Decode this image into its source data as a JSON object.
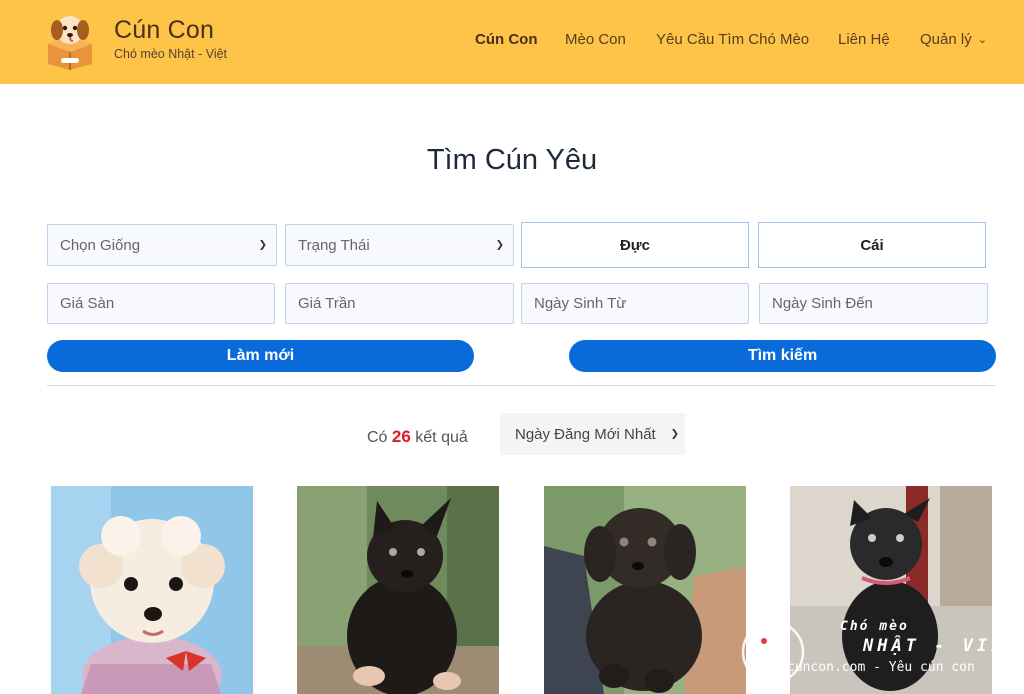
{
  "header": {
    "brand_title": "Cún Con",
    "brand_subtitle": "Chó mèo Nhật - Việt",
    "logo_icon": "puppy-in-box-logo",
    "nav": [
      {
        "label": "Cún Con",
        "active": true
      },
      {
        "label": "Mèo Con",
        "active": false
      },
      {
        "label": "Yêu Cầu Tìm Chó Mèo",
        "active": false
      },
      {
        "label": "Liên Hệ",
        "active": false
      },
      {
        "label": "Quản lý",
        "active": false,
        "dropdown": true
      }
    ]
  },
  "page": {
    "title": "Tìm Cún Yêu"
  },
  "filters": {
    "breed_select": "Chọn Giống",
    "status_select": "Trạng Thái",
    "male_button": "Đực",
    "female_button": "Cái",
    "price_min_placeholder": "Giá Sàn",
    "price_max_placeholder": "Giá Trần",
    "birth_from_placeholder": "Ngày Sinh Từ",
    "birth_to_placeholder": "Ngày Sinh Đến",
    "reset_button": "Làm mới",
    "search_button": "Tìm kiếm"
  },
  "results": {
    "prefix": "Có",
    "count": "26",
    "suffix": "kết quả",
    "sort_select": "Ngày Đăng Mới Nhất"
  },
  "watermark": {
    "line1": "Chó mèo",
    "line2": "NHẬT - VIỆT",
    "line3": "cuncon.com - Yêu cún con"
  },
  "colors": {
    "header_bg": "#fdc447",
    "primary_button": "#0a6ad9",
    "count_red": "#e0191f"
  }
}
